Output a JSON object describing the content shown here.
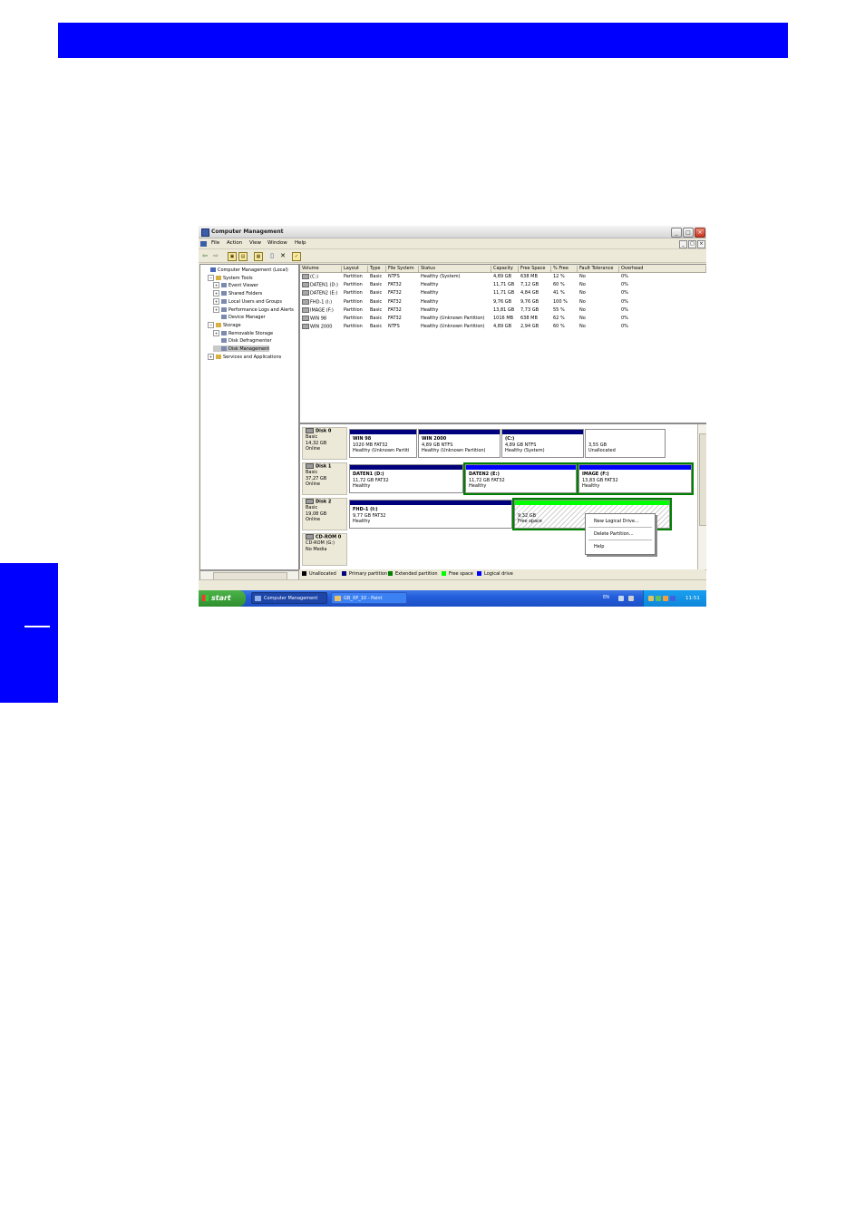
{
  "window": {
    "title": "Computer Management",
    "controls": [
      "_",
      "□",
      "×"
    ]
  },
  "menu": [
    "File",
    "Action",
    "View",
    "Window",
    "Help"
  ],
  "mdi_controls": [
    "_",
    "□",
    "×"
  ],
  "tree": [
    {
      "label": "Computer Management (Local)",
      "indent": 0,
      "expander": "",
      "selected": false
    },
    {
      "label": "System Tools",
      "indent": 1,
      "expander": "−",
      "selected": false
    },
    {
      "label": "Event Viewer",
      "indent": 2,
      "expander": "+",
      "selected": false
    },
    {
      "label": "Shared Folders",
      "indent": 2,
      "expander": "+",
      "selected": false
    },
    {
      "label": "Local Users and Groups",
      "indent": 2,
      "expander": "+",
      "selected": false
    },
    {
      "label": "Performance Logs and Alerts",
      "indent": 2,
      "expander": "+",
      "selected": false
    },
    {
      "label": "Device Manager",
      "indent": 2,
      "expander": "",
      "selected": false
    },
    {
      "label": "Storage",
      "indent": 1,
      "expander": "−",
      "selected": false
    },
    {
      "label": "Removable Storage",
      "indent": 2,
      "expander": "+",
      "selected": false
    },
    {
      "label": "Disk Defragmenter",
      "indent": 2,
      "expander": "",
      "selected": false
    },
    {
      "label": "Disk Management",
      "indent": 2,
      "expander": "",
      "selected": true
    },
    {
      "label": "Services and Applications",
      "indent": 1,
      "expander": "+",
      "selected": false
    }
  ],
  "volume_columns": [
    "Volume",
    "Layout",
    "Type",
    "File System",
    "Status",
    "Capacity",
    "Free Space",
    "% Free",
    "Fault Tolerance",
    "Overhead"
  ],
  "volumes": [
    [
      "(C:)",
      "Partition",
      "Basic",
      "NTFS",
      "Healthy (System)",
      "4,89 GB",
      "638 MB",
      "12 %",
      "No",
      "0%"
    ],
    [
      "DATEN1 (D:)",
      "Partition",
      "Basic",
      "FAT32",
      "Healthy",
      "11,71 GB",
      "7,12 GB",
      "60 %",
      "No",
      "0%"
    ],
    [
      "DATEN2 (E:)",
      "Partition",
      "Basic",
      "FAT32",
      "Healthy",
      "11,71 GB",
      "4,84 GB",
      "41 %",
      "No",
      "0%"
    ],
    [
      "FHD-1 (I:)",
      "Partition",
      "Basic",
      "FAT32",
      "Healthy",
      "9,76 GB",
      "9,76 GB",
      "100 %",
      "No",
      "0%"
    ],
    [
      "IMAGE (F:)",
      "Partition",
      "Basic",
      "FAT32",
      "Healthy",
      "13,81 GB",
      "7,73 GB",
      "55 %",
      "No",
      "0%"
    ],
    [
      "WIN 98",
      "Partition",
      "Basic",
      "FAT32",
      "Healthy (Unknown Partition)",
      "1016 MB",
      "638 MB",
      "62 %",
      "No",
      "0%"
    ],
    [
      "WIN 2000",
      "Partition",
      "Basic",
      "NTFS",
      "Healthy (Unknown Partition)",
      "4,89 GB",
      "2,94 GB",
      "60 %",
      "No",
      "0%"
    ]
  ],
  "disks": [
    {
      "name": "Disk 0",
      "type": "Basic",
      "size": "14,32 GB",
      "state": "Online",
      "partitions": [
        {
          "title": "WIN 98",
          "line1": "1020 MB FAT32",
          "line2": "Healthy (Unknown Partiti",
          "kind": "primary"
        },
        {
          "title": "WIN 2000",
          "line1": "4,89 GB NTFS",
          "line2": "Healthy (Unknown Partition)",
          "kind": "primary"
        },
        {
          "title": "(C:)",
          "line1": "4,89 GB NTFS",
          "line2": "Healthy (System)",
          "kind": "primary"
        },
        {
          "title": "",
          "line1": "3,55 GB",
          "line2": "Unallocated",
          "kind": "unallocated"
        }
      ]
    },
    {
      "name": "Disk 1",
      "type": "Basic",
      "size": "37,27 GB",
      "state": "Online",
      "partitions": [
        {
          "title": "DATEN1  (D:)",
          "line1": "11,72 GB FAT32",
          "line2": "Healthy",
          "kind": "primary"
        },
        {
          "title": "DATEN2  (E:)",
          "line1": "11,72 GB FAT32",
          "line2": "Healthy",
          "kind": "logical"
        },
        {
          "title": "IMAGE  (F:)",
          "line1": "13,83 GB FAT32",
          "line2": "Healthy",
          "kind": "logical"
        }
      ]
    },
    {
      "name": "Disk 2",
      "type": "Basic",
      "size": "19,08 GB",
      "state": "Online",
      "partitions": [
        {
          "title": "FHD-1  (I:)",
          "line1": "9,77 GB FAT32",
          "line2": "Healthy",
          "kind": "primary"
        },
        {
          "title": "",
          "line1": "9,32 GB",
          "line2": "Free space",
          "kind": "free"
        }
      ]
    },
    {
      "name": "CD-ROM 0",
      "type": "CD-ROM (G:)",
      "size": "",
      "state": "No Media",
      "partitions": []
    }
  ],
  "context_menu": [
    "New Logical Drive...",
    "Delete Partition...",
    "Help"
  ],
  "legend": [
    {
      "label": "Unallocated",
      "color": "#000000"
    },
    {
      "label": "Primary partition",
      "color": "#00007c"
    },
    {
      "label": "Extended partition",
      "color": "#008000"
    },
    {
      "label": "Free space",
      "color": "#00ff00"
    },
    {
      "label": "Logical drive",
      "color": "#0000ff"
    }
  ],
  "taskbar": {
    "start": "start",
    "tasks": [
      "Computer Management",
      "GB_XP_10 - Paint"
    ],
    "language": "EN",
    "clock": "11:51"
  }
}
